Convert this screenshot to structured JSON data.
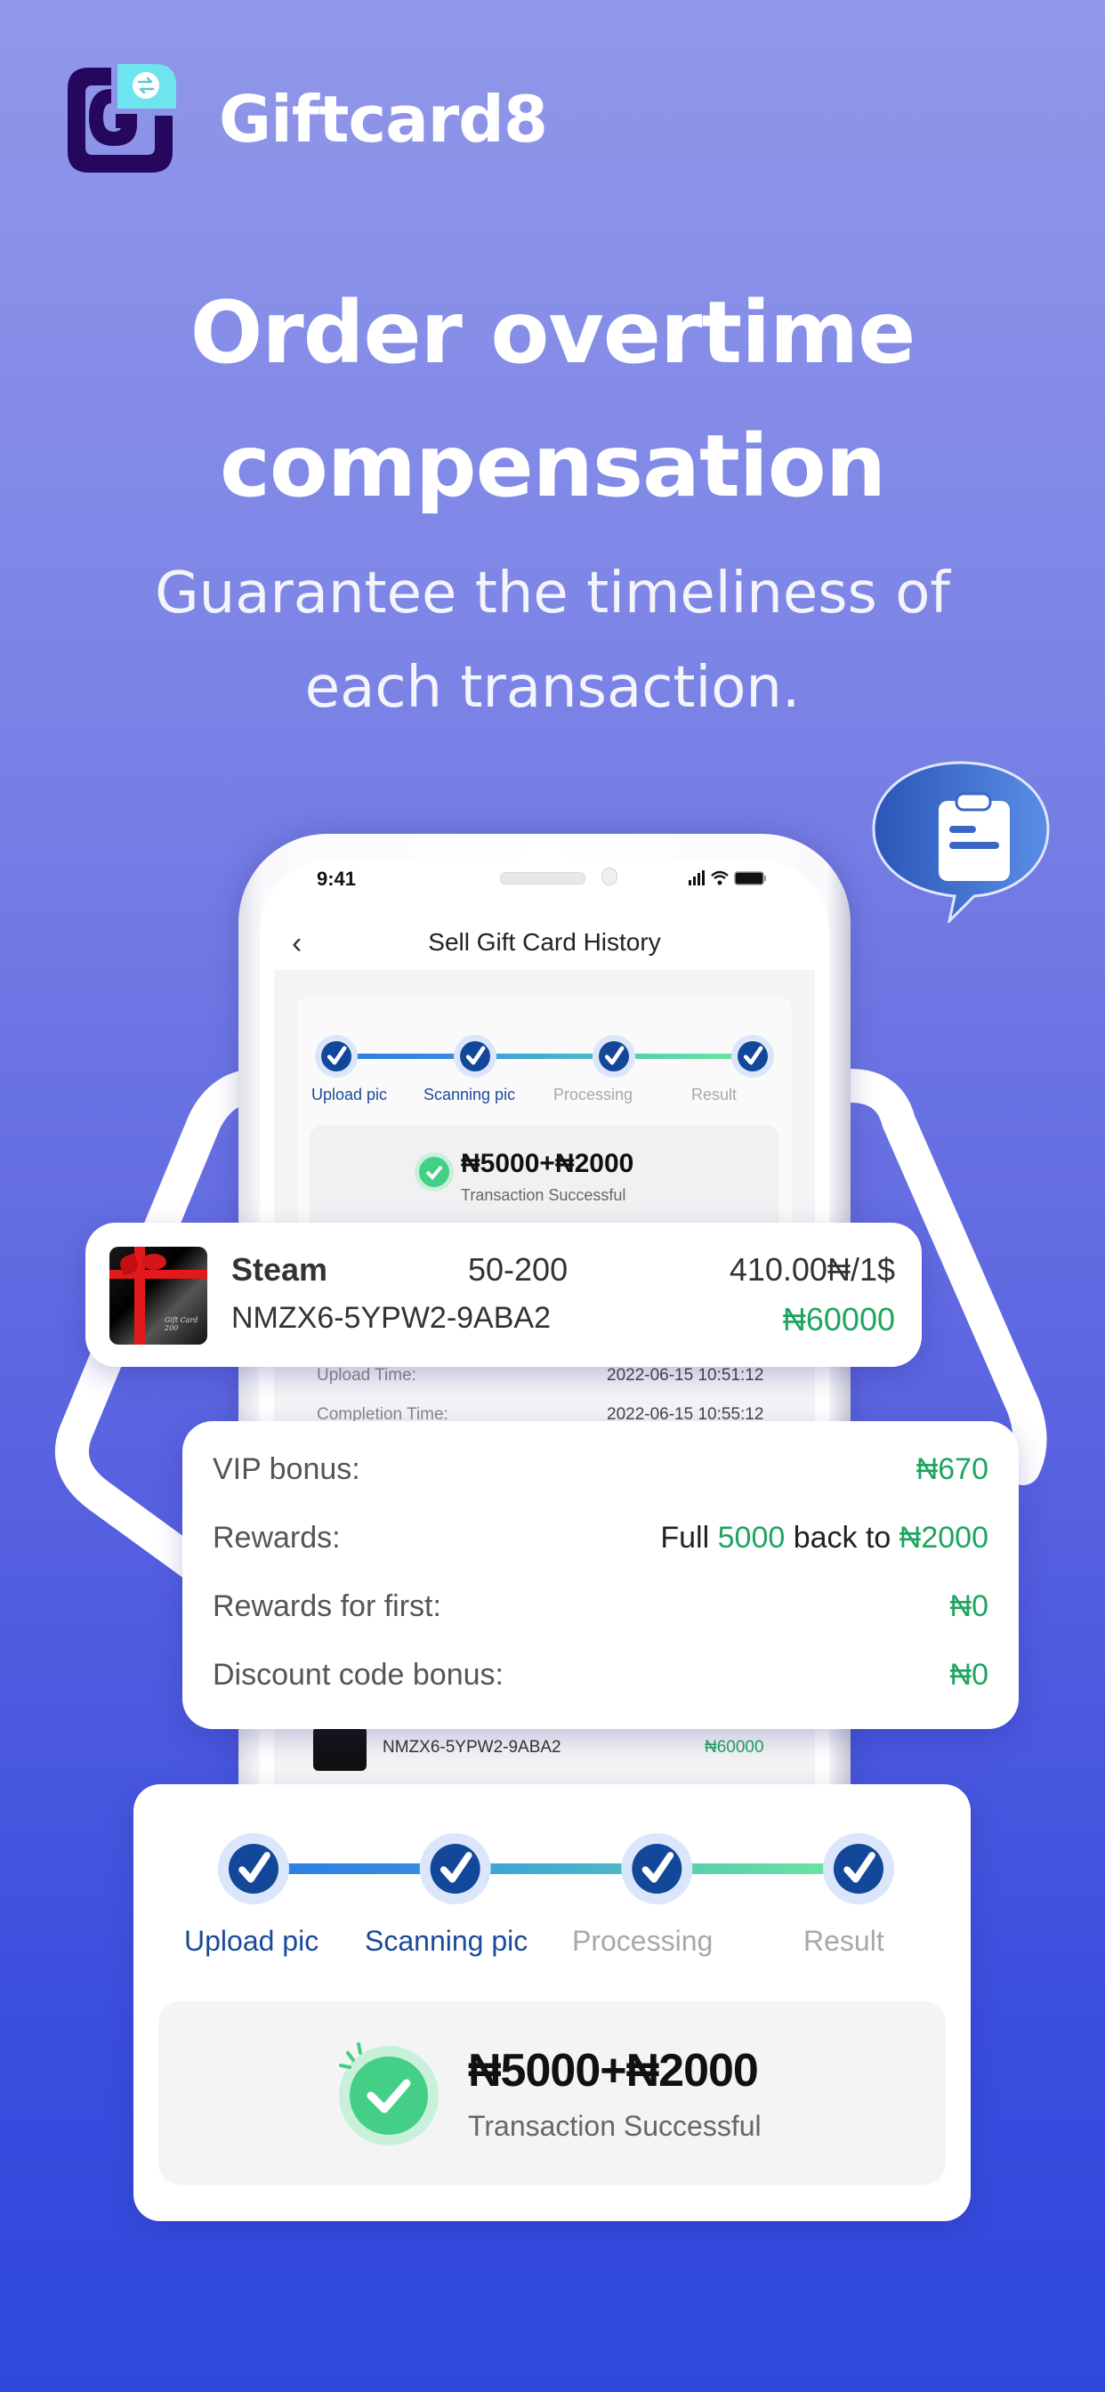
{
  "brand": {
    "name": "Giftcard8"
  },
  "headline": {
    "line1": "Order overtime",
    "line2": "compensation"
  },
  "subheadline": {
    "line1": "Guarantee the timeliness of",
    "line2": "each transaction."
  },
  "colors": {
    "accent_green": "#1ea55f",
    "step_blue": "#1b4a9a",
    "step_inactive": "#a8a8a8",
    "logo_dark": "#26075e",
    "logo_teal": "#6ee4ee"
  },
  "phone": {
    "status_time": "9:41",
    "nav_title": "Sell Gift Card History",
    "steps": [
      "Upload pic",
      "Scanning pic",
      "Processing",
      "Result"
    ],
    "result_amount": "₦5000+₦2000",
    "result_status": "Transaction Successful",
    "details": [
      {
        "label": "Upload Time:",
        "value": "2022-06-15 10:51:12"
      },
      {
        "label": "Completion Time:",
        "value": "2022-06-15 10:55:12"
      }
    ],
    "footer_code": "NMZX6-5YPW2-9ABA2",
    "footer_amount": "₦60000"
  },
  "gift_card": {
    "thumb_text": "Gift Card 200",
    "name": "Steam",
    "range": "50-200",
    "rate": "410.00₦/1$",
    "code": "NMZX6-5YPW2-9ABA2",
    "amount": "₦60000"
  },
  "bonus": {
    "vip_label": "VIP bonus:",
    "vip_value": "₦670",
    "rewards_label": "Rewards:",
    "rewards_full": "Full",
    "rewards_threshold": "5000",
    "rewards_back": "back to",
    "rewards_amount": "₦2000",
    "first_label": "Rewards for first:",
    "first_value": "₦0",
    "discount_label": "Discount code bonus:",
    "discount_value": "₦0"
  },
  "progress": {
    "steps": [
      {
        "label": "Upload pic",
        "state": "active"
      },
      {
        "label": "Scanning pic",
        "state": "active"
      },
      {
        "label": "Processing",
        "state": "inactive"
      },
      {
        "label": "Result",
        "state": "inactive"
      }
    ],
    "result_amount": "₦5000+₦2000",
    "result_status": "Transaction Successful"
  }
}
